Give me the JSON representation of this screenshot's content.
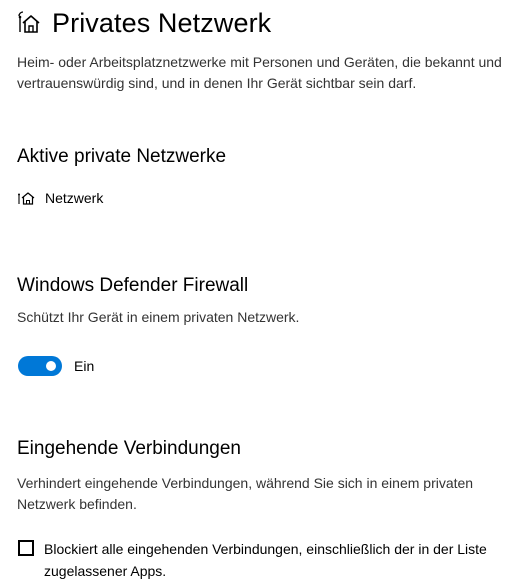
{
  "header": {
    "icon": "home-network-icon",
    "title": "Privates Netzwerk"
  },
  "intro": {
    "description": "Heim- oder Arbeitsplatznetzwerke mit Personen und Geräten, die bekannt und vertrauenswürdig sind, und in denen Ihr Gerät sichtbar sein darf."
  },
  "active_networks": {
    "title": "Aktive private Netzwerke",
    "network": {
      "icon": "home-network-icon",
      "name": "Netzwerk"
    }
  },
  "firewall": {
    "title": "Windows Defender Firewall",
    "description": "Schützt Ihr Gerät in einem privaten Netzwerk.",
    "toggle_state": true,
    "toggle_label": "Ein",
    "accent_color": "#0078d7"
  },
  "incoming": {
    "title": "Eingehende Verbindungen",
    "description": "Verhindert eingehende Verbindungen, während Sie sich in einem privaten Netzwerk befinden.",
    "checkbox_checked": false,
    "checkbox_label": "Blockiert alle eingehenden Verbindungen, einschließlich der in der Liste zugelassener Apps."
  }
}
